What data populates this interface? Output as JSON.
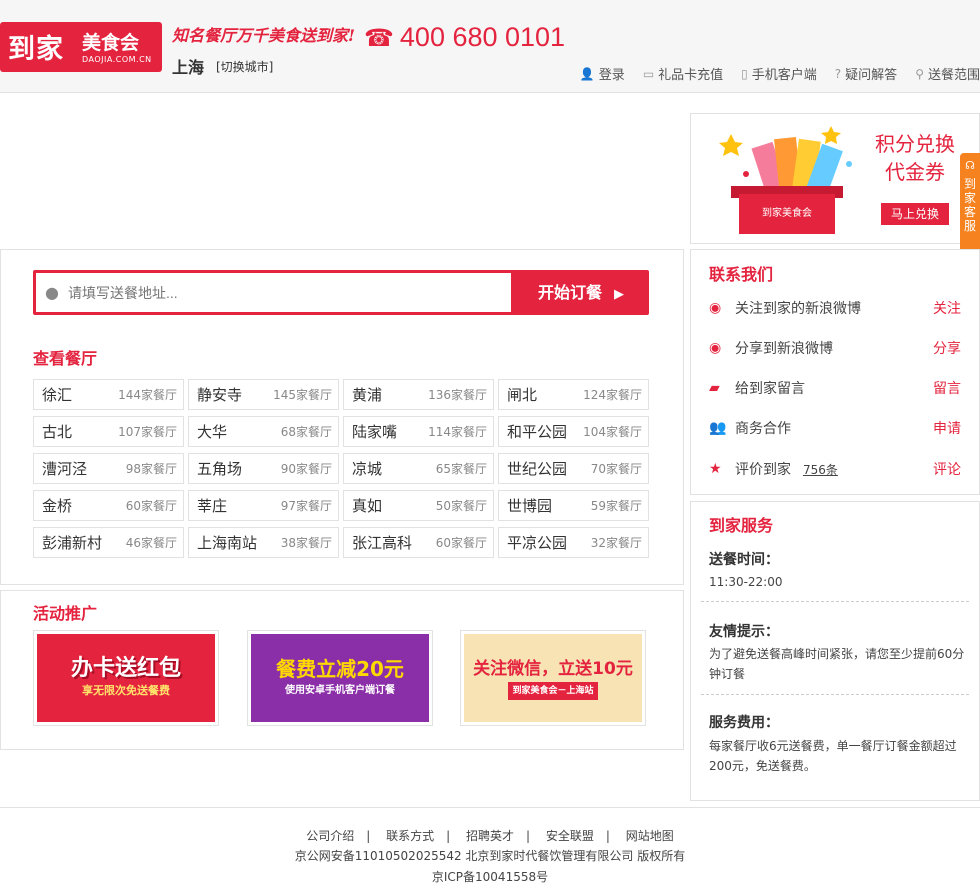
{
  "header": {
    "logo_main": "到家",
    "logo_sub": "美食会",
    "logo_domain": "DAOJIA.COM.CN",
    "slogan": "知名餐厅万千美食送到家!",
    "phone": "400 680 0101",
    "city": "上海",
    "switch_city": "[切换城市]",
    "nav": [
      {
        "label": "登录",
        "icon": "user-icon"
      },
      {
        "label": "礼品卡充值",
        "icon": "card-icon"
      },
      {
        "label": "手机客户端",
        "icon": "mobile-icon"
      },
      {
        "label": "疑问解答",
        "icon": "question-icon"
      },
      {
        "label": "送餐范围",
        "icon": "location-icon"
      }
    ]
  },
  "banner": {
    "title_1": "积分兑换",
    "title_2": "代金券",
    "button": "马上兑换",
    "gift_label": "到家美食会"
  },
  "side_tab": "到家客服",
  "search": {
    "placeholder": "请填写送餐地址...",
    "button": "开始订餐"
  },
  "restaurants": {
    "title": "查看餐厅",
    "districts": [
      {
        "name": "徐汇",
        "count": "144家餐厅"
      },
      {
        "name": "静安寺",
        "count": "145家餐厅"
      },
      {
        "name": "黄浦",
        "count": "136家餐厅"
      },
      {
        "name": "闸北",
        "count": "124家餐厅"
      },
      {
        "name": "古北",
        "count": "107家餐厅"
      },
      {
        "name": "大华",
        "count": "68家餐厅"
      },
      {
        "name": "陆家嘴",
        "count": "114家餐厅"
      },
      {
        "name": "和平公园",
        "count": "104家餐厅"
      },
      {
        "name": "漕河泾",
        "count": "98家餐厅"
      },
      {
        "name": "五角场",
        "count": "90家餐厅"
      },
      {
        "name": "凉城",
        "count": "65家餐厅"
      },
      {
        "name": "世纪公园",
        "count": "70家餐厅"
      },
      {
        "name": "金桥",
        "count": "60家餐厅"
      },
      {
        "name": "莘庄",
        "count": "97家餐厅"
      },
      {
        "name": "真如",
        "count": "50家餐厅"
      },
      {
        "name": "世博园",
        "count": "59家餐厅"
      },
      {
        "name": "彭浦新村",
        "count": "46家餐厅"
      },
      {
        "name": "上海南站",
        "count": "38家餐厅"
      },
      {
        "name": "张江高科",
        "count": "60家餐厅"
      },
      {
        "name": "平凉公园",
        "count": "32家餐厅"
      }
    ]
  },
  "promotions": {
    "title": "活动推广",
    "items": [
      {
        "headline": "办卡送红包",
        "sub": "享无限次免送餐费",
        "bg": "#e4243f"
      },
      {
        "headline": "餐费立减20元",
        "sub": "使用安卓手机客户端订餐",
        "bg": "#8b2fa8"
      },
      {
        "headline": "关注微信，立送10元",
        "sub": "到家美食会－上海站",
        "bg": "#f7e3b4"
      }
    ]
  },
  "contact": {
    "title": "联系我们",
    "rows": [
      {
        "label": "关注到家的新浪微博",
        "action": "关注",
        "icon": "weibo-icon"
      },
      {
        "label": "分享到新浪微博",
        "action": "分享",
        "icon": "weibo-icon"
      },
      {
        "label": "给到家留言",
        "action": "留言",
        "icon": "message-icon"
      },
      {
        "label": "商务合作",
        "action": "申请",
        "icon": "people-icon"
      },
      {
        "label": "评价到家",
        "count": "756条",
        "action": "评论",
        "icon": "star-icon"
      }
    ]
  },
  "service": {
    "title": "到家服务",
    "time_label": "送餐时间：",
    "time_value": "11:30-22:00",
    "tip_label": "友情提示：",
    "tip_text": "为了避免送餐高峰时间紧张，请您至少提前60分钟订餐",
    "fee_label": "服务费用：",
    "fee_text": "每家餐厅收6元送餐费，单一餐厅订餐金额超过200元，免送餐费。"
  },
  "footer": {
    "links": [
      "公司介绍",
      "联系方式",
      "招聘英才",
      "安全联盟",
      "网站地图"
    ],
    "separator": "|",
    "line1": "京公网安备11010502025542 北京到家时代餐饮管理有限公司 版权所有",
    "line2": "京ICP备10041558号"
  },
  "colors": {
    "brand": "#e4243f",
    "side_tab": "#f5821f"
  }
}
